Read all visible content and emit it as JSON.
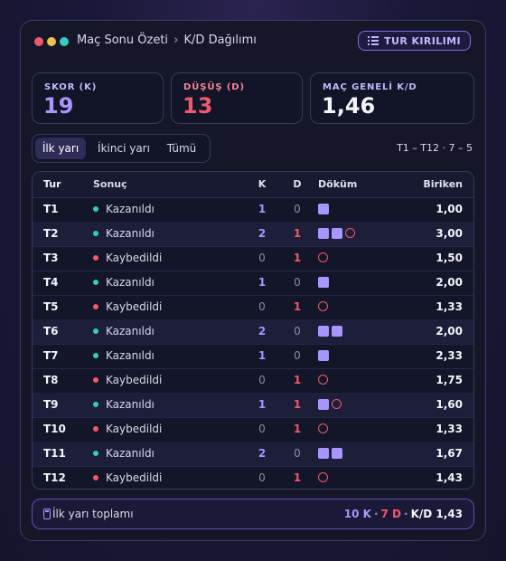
{
  "window": {
    "breadcrumb_parent": "Maç Sonu Özeti",
    "breadcrumb_sep": "›",
    "breadcrumb_current": "K/D Dağılımı",
    "tur_button": "TUR KIRILIMI"
  },
  "stats": {
    "kills": {
      "label": "SKOR (K)",
      "value": "19"
    },
    "deaths": {
      "label": "DÜŞÜŞ (D)",
      "value": "13"
    },
    "kd": {
      "label": "MAÇ GENELİ K/D",
      "value": "1,46"
    }
  },
  "tabs": [
    "İlk yarı",
    "İkinci yarı",
    "Tümü"
  ],
  "selected_tab": "İlk yarı",
  "range_label": "T1 – T12 · 7 – 5",
  "table": {
    "headers": {
      "tur": "Tur",
      "sonuc": "Sonuç",
      "k": "K",
      "d": "D",
      "dokum": "Döküm",
      "biriken": "Biriken"
    },
    "rows": [
      {
        "tur": "T1",
        "sonuc": "Kazanıldı",
        "win": true,
        "k": "1",
        "d": "0",
        "sum": "1,00"
      },
      {
        "tur": "T2",
        "sonuc": "Kazanıldı",
        "win": true,
        "k": "2",
        "d": "1",
        "sum": "3,00"
      },
      {
        "tur": "T3",
        "sonuc": "Kaybedildi",
        "win": false,
        "k": "0",
        "d": "1",
        "sum": "1,50"
      },
      {
        "tur": "T4",
        "sonuc": "Kazanıldı",
        "win": true,
        "k": "1",
        "d": "0",
        "sum": "2,00"
      },
      {
        "tur": "T5",
        "sonuc": "Kaybedildi",
        "win": false,
        "k": "0",
        "d": "1",
        "sum": "1,33"
      },
      {
        "tur": "T6",
        "sonuc": "Kazanıldı",
        "win": true,
        "k": "2",
        "d": "0",
        "sum": "2,00"
      },
      {
        "tur": "T7",
        "sonuc": "Kazanıldı",
        "win": true,
        "k": "1",
        "d": "0",
        "sum": "2,33"
      },
      {
        "tur": "T8",
        "sonuc": "Kaybedildi",
        "win": false,
        "k": "0",
        "d": "1",
        "sum": "1,75"
      },
      {
        "tur": "T9",
        "sonuc": "Kazanıldı",
        "win": true,
        "k": "1",
        "d": "1",
        "sum": "1,60"
      },
      {
        "tur": "T10",
        "sonuc": "Kaybedildi",
        "win": false,
        "k": "0",
        "d": "1",
        "sum": "1,33"
      },
      {
        "tur": "T11",
        "sonuc": "Kazanıldı",
        "win": true,
        "k": "2",
        "d": "0",
        "sum": "1,67"
      },
      {
        "tur": "T12",
        "sonuc": "Kaybedildi",
        "win": false,
        "k": "0",
        "d": "1",
        "sum": "1,43"
      }
    ]
  },
  "footer": {
    "label": "İlk yarı toplamı",
    "kills": "10 K",
    "deaths": "7 D",
    "sep": "·",
    "kd": "K/D 1,43"
  },
  "colors": {
    "accent": "#a796ff",
    "win": "#38c9c1",
    "loss": "#f0596d",
    "background": "#151729"
  }
}
